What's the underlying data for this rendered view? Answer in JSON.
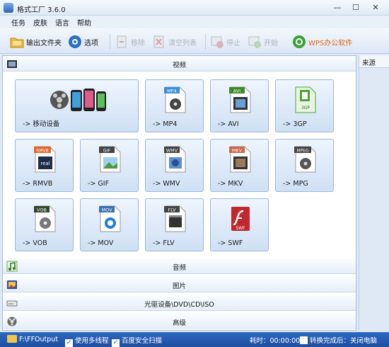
{
  "window": {
    "title": "格式工厂 3.6.0"
  },
  "menu": [
    "任务",
    "皮肤",
    "语言",
    "帮助"
  ],
  "toolbar": {
    "output_folder": "输出文件夹",
    "options": "选项",
    "remove": "移除",
    "clear_list": "清空列表",
    "stop": "停止",
    "start": "开始",
    "wps": "WPS办公软件"
  },
  "categories": {
    "video": "视频",
    "audio": "音频",
    "picture": "图片",
    "rom": "光驱设备\\DVD\\CD\\ISO",
    "advanced": "高级"
  },
  "tiles": [
    {
      "label": "-> 移动设备"
    },
    {
      "label": "-> MP4",
      "badge": "MP4",
      "badge_color": "#3a8fd6"
    },
    {
      "label": "-> AVI",
      "badge": "AVI",
      "badge_color": "#3d8a2a"
    },
    {
      "label": "-> 3GP",
      "badge": "3GP",
      "badge_color": "#4ea336"
    },
    {
      "label": "-> RMVB",
      "badge": "RMVB",
      "badge_color": "#e0662a"
    },
    {
      "label": "-> GIF",
      "badge": "GIF",
      "badge_color": "#444444"
    },
    {
      "label": "-> WMV",
      "badge": "WMV",
      "badge_color": "#444444"
    },
    {
      "label": "-> MKV",
      "badge": "MKV",
      "badge_color": "#c9684a"
    },
    {
      "label": "-> MPG",
      "badge": "MPEG",
      "badge_color": "#444444"
    },
    {
      "label": "-> VOB",
      "badge": "VOB",
      "badge_color": "#2f4a2a"
    },
    {
      "label": "-> MOV",
      "badge": "MOV",
      "badge_color": "#3a6fb0"
    },
    {
      "label": "-> FLV",
      "badge": "FLV",
      "badge_color": "#444444"
    },
    {
      "label": "-> SWF",
      "badge": "SWF",
      "badge_color": "#c0282d"
    }
  ],
  "sidebar": {
    "header": "来源"
  },
  "status": {
    "output_path": "F:\\FFOutput",
    "multithread": "使用多线程",
    "baidu_scan": "百度安全扫描",
    "elapsed": "耗时：00:00:00",
    "after_done": "转换完成后：关闭电脑"
  }
}
